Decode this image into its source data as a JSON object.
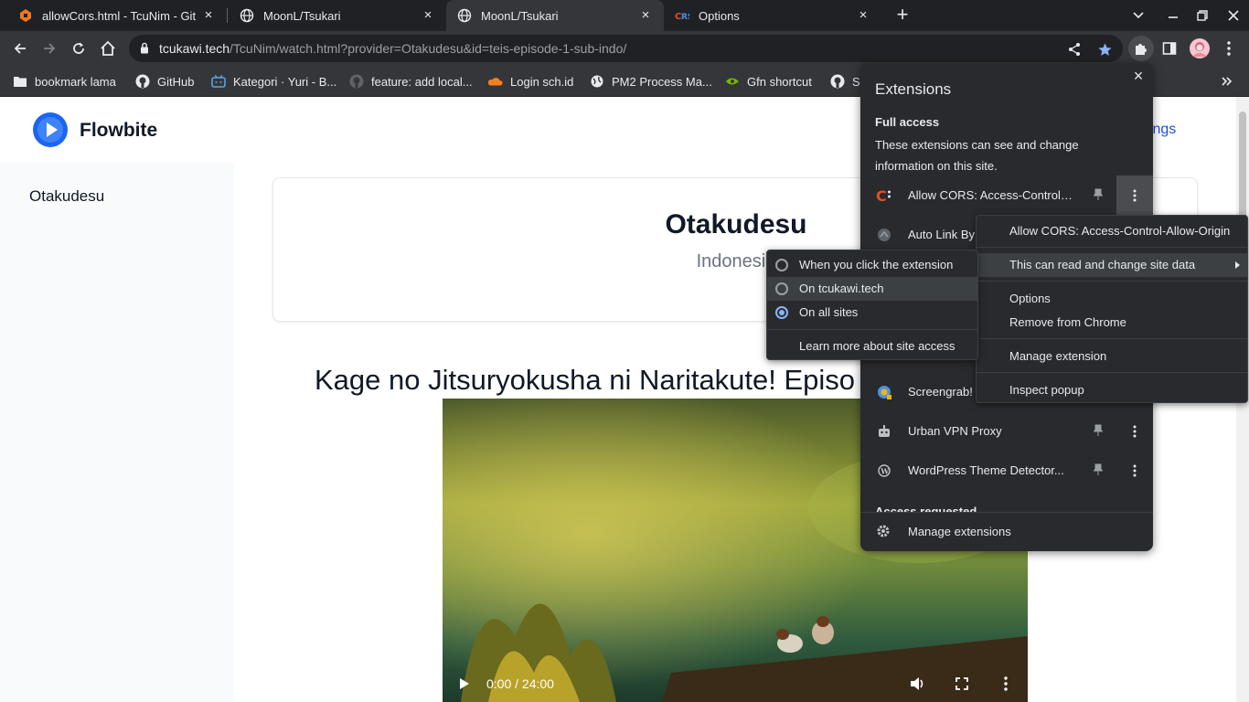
{
  "tabs": [
    {
      "title": "allowCors.html - TcuNim - Git",
      "icon": "gitea-icon",
      "active": false
    },
    {
      "title": "MoonL/Tsukari",
      "icon": "globe-icon",
      "active": false
    },
    {
      "title": "MoonL/Tsukari",
      "icon": "globe-icon",
      "active": true
    },
    {
      "title": "Options",
      "icon": "cors-icon",
      "active": false
    }
  ],
  "omnibox": {
    "host": "tcukawi.tech",
    "path": "/TcuNim/watch.html?provider=Otakudesu&id=teis-episode-1-sub-indo/"
  },
  "bookmarks": [
    {
      "label": "bookmark lama",
      "icon": "folder-icon"
    },
    {
      "label": "GitHub",
      "icon": "github-icon"
    },
    {
      "label": "Kategori · Yuri - B...",
      "icon": "bilibili-icon"
    },
    {
      "label": "feature: add local...",
      "icon": "github-icon"
    },
    {
      "label": "Login sch.id",
      "icon": "cloudflare-icon"
    },
    {
      "label": "PM2 Process Ma...",
      "icon": "globe-icon"
    },
    {
      "label": "Gfn shortcut",
      "icon": "nvidia-icon"
    },
    {
      "label": "Se",
      "icon": "github-icon"
    }
  ],
  "page": {
    "brand": "Flowbite",
    "settings_link": "ttings",
    "sidebar_item": "Otakudesu",
    "card_title": "Otakudesu",
    "card_subtitle": "Indonesia",
    "episode_title": "Kage no Jitsuryokusha ni Naritakute! Episo",
    "video_time": "0:00 / 24:00"
  },
  "extensions_popup": {
    "title": "Extensions",
    "section": "Full access",
    "description": "These extensions can see and change information on this site.",
    "items": [
      {
        "name": "Allow CORS: Access-Control-...",
        "icon": "cors-icon"
      },
      {
        "name": "Auto Link By",
        "icon": "link-icon"
      },
      {
        "name": "",
        "icon": "yellow-icon"
      },
      {
        "name": "Screengrab!",
        "icon": "screengrab-icon"
      },
      {
        "name": "Urban VPN Proxy",
        "icon": "robot-icon"
      },
      {
        "name": "WordPress Theme Detector...",
        "icon": "wordpress-icon"
      }
    ],
    "access_requested": "Access requested",
    "footer": "Manage extensions"
  },
  "context_menu": {
    "items": [
      {
        "label": "Allow CORS: Access-Control-Allow-Origin"
      },
      {
        "label": "This can read and change site data"
      },
      {
        "label": "Options"
      },
      {
        "label": "Remove from Chrome"
      },
      {
        "label": "Manage extension"
      },
      {
        "label": "Inspect popup"
      }
    ]
  },
  "site_access_menu": {
    "options": [
      {
        "label": "When you click the extension",
        "selected": false
      },
      {
        "label": "On tcukawi.tech",
        "selected": false
      },
      {
        "label": "On all sites",
        "selected": true
      }
    ],
    "learn_more": "Learn more about site access"
  },
  "colors": {
    "accent": "#8ab4f8",
    "link": "#1d4ed8",
    "dark_bg": "#202124",
    "toolbar_bg": "#35363a",
    "menu_bg": "#292a2d"
  }
}
